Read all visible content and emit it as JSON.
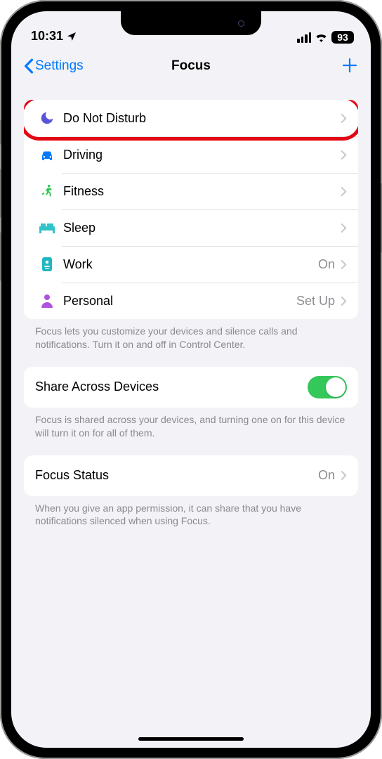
{
  "status": {
    "time": "10:31",
    "battery": "93"
  },
  "nav": {
    "back": "Settings",
    "title": "Focus"
  },
  "focus_modes": [
    {
      "label": "Do Not Disturb",
      "trailing": "",
      "highlighted": true,
      "icon_color": "#5856d6"
    },
    {
      "label": "Driving",
      "trailing": "",
      "highlighted": false,
      "icon_color": "#007aff"
    },
    {
      "label": "Fitness",
      "trailing": "",
      "highlighted": false,
      "icon_color": "#34c759"
    },
    {
      "label": "Sleep",
      "trailing": "",
      "highlighted": false,
      "icon_color": "#30c2c9"
    },
    {
      "label": "Work",
      "trailing": "On",
      "highlighted": false,
      "icon_color": "#1fb7c0"
    },
    {
      "label": "Personal",
      "trailing": "Set Up",
      "highlighted": false,
      "icon_color": "#af52de"
    }
  ],
  "footers": {
    "modes": "Focus lets you customize your devices and silence calls and notifications. Turn it on and off in Control Center.",
    "share": "Focus is shared across your devices, and turning one on for this device will turn it on for all of them.",
    "status": "When you give an app permission, it can share that you have notifications silenced when using Focus."
  },
  "share": {
    "label": "Share Across Devices",
    "on": true
  },
  "focus_status": {
    "label": "Focus Status",
    "trailing": "On"
  }
}
